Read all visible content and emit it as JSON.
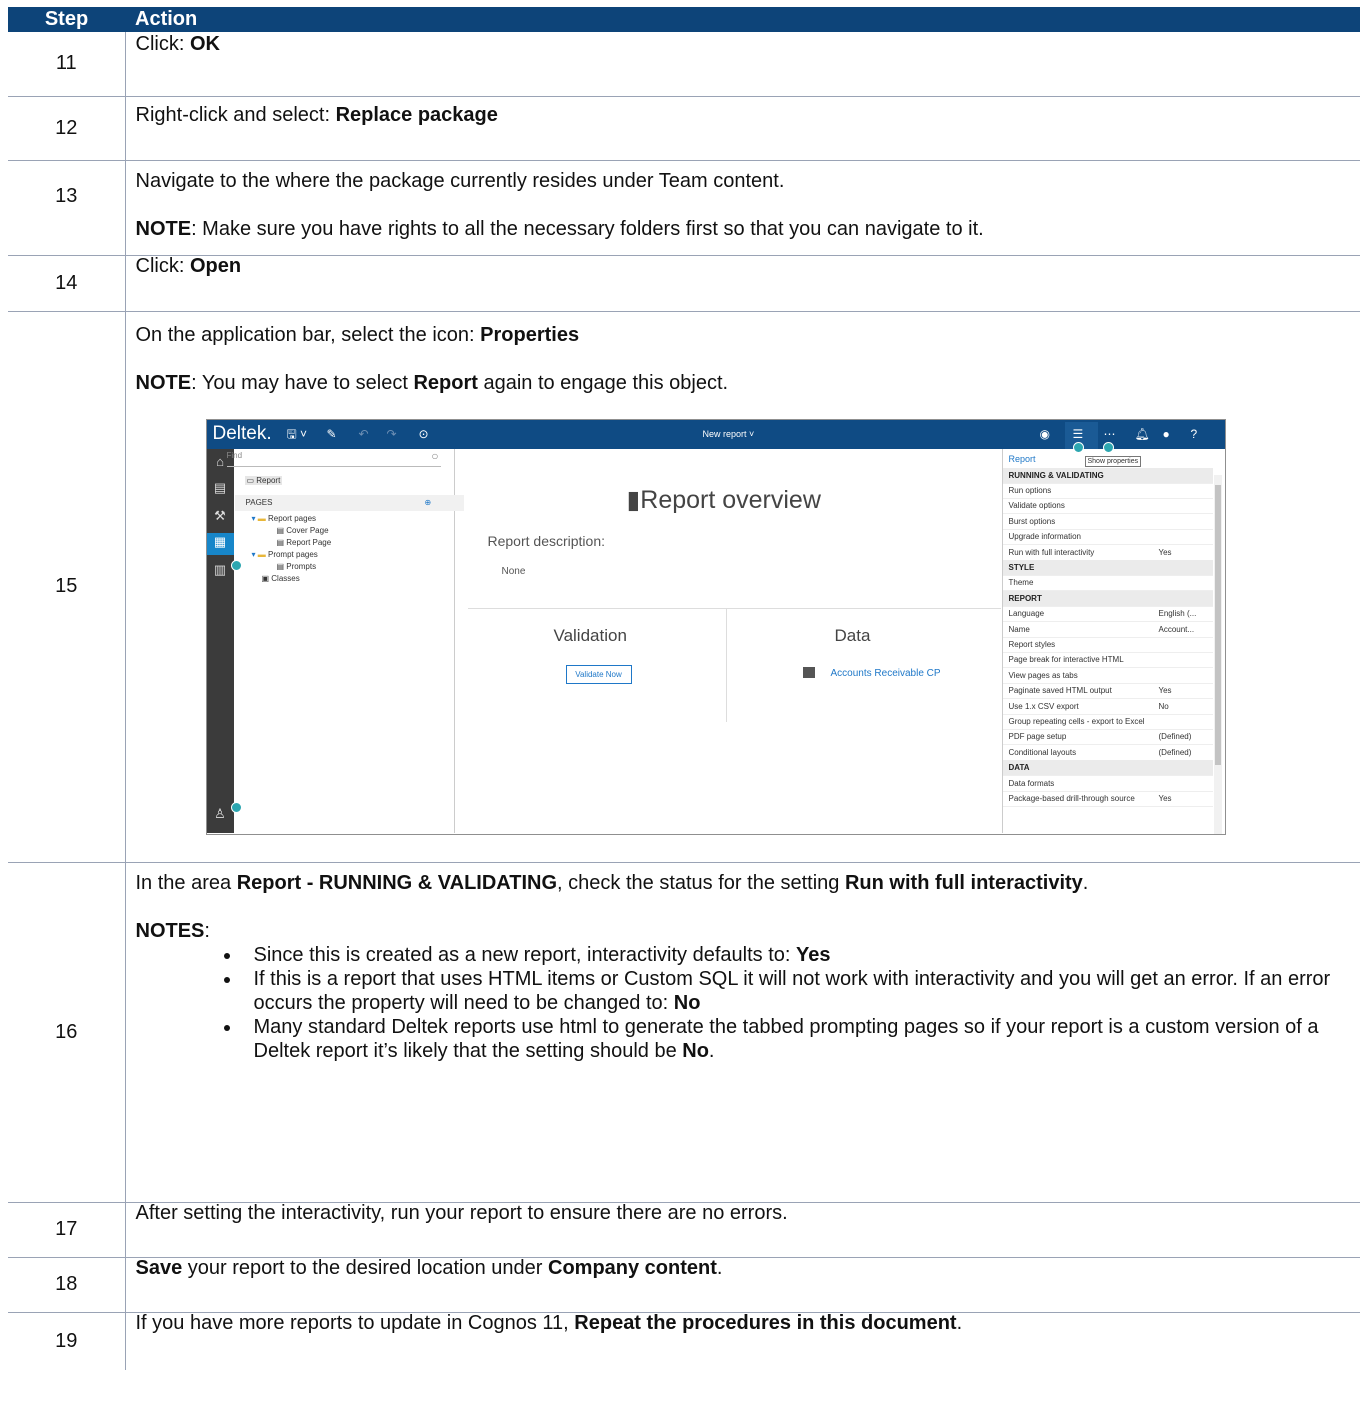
{
  "header": {
    "step": "Step",
    "action": "Action"
  },
  "steps": [
    {
      "num": "11",
      "text": "Click: ",
      "bold": "OK"
    },
    {
      "num": "12",
      "text": "Right-click and select: ",
      "bold": "Replace package"
    },
    {
      "num": "13",
      "line1": "Navigate to the where the package currently resides under Team content.",
      "note_label": "NOTE",
      "note_text": ": Make sure you have rights to all the necessary folders first so that you can navigate to it."
    },
    {
      "num": "14",
      "text": "Click: ",
      "bold": "Open"
    },
    {
      "num": "15",
      "text": "On the application bar, select the icon: ",
      "bold": "Properties",
      "note_label": "NOTE",
      "note_pre": ": You may have to select ",
      "note_bold": "Report",
      "note_post": " again to engage this object."
    },
    {
      "num": "16",
      "pre": "In the area ",
      "b1": "Report - RUNNING & VALIDATING",
      "mid": ", check the status for the setting ",
      "b2": "Run with full interactivity",
      "end": ".",
      "notes_label": "NOTES",
      "notes_colon": ":",
      "bullets": [
        {
          "text": "Since this is created as a new report, interactivity defaults to: ",
          "bold": "Yes",
          "post": ""
        },
        {
          "text": "If this is a report that uses HTML items or Custom SQL it will not work with interactivity and you will get an error. If an error occurs the property will need to be changed to: ",
          "bold": "No",
          "post": ""
        },
        {
          "text": "Many standard Deltek reports use html to generate the tabbed prompting pages so if your report is a custom version of a Deltek report it’s likely that the setting should be ",
          "bold": "No",
          "post": "."
        }
      ]
    },
    {
      "num": "17",
      "text": "After setting the interactivity, run your report to ensure there are no errors."
    },
    {
      "num": "18",
      "b1": "Save",
      "mid": " your report to the desired location under ",
      "b2": "Company content",
      "end": "."
    },
    {
      "num": "19",
      "text": "If you have more reports to update in Cognos 11, ",
      "bold": "Repeat the procedures in this document",
      "end": "."
    }
  ],
  "screenshot": {
    "logo": "Deltek.",
    "title": "New report",
    "find_placeholder": "Find",
    "tree": {
      "report": "Report",
      "pages": "PAGES",
      "report_pages": "Report pages",
      "cover_page": "Cover Page",
      "report_page": "Report Page",
      "prompt_pages": "Prompt pages",
      "prompts": "Prompts",
      "classes": "Classes"
    },
    "overview_title": "Report overview",
    "report_description": "Report description:",
    "none": "None",
    "validation": "Validation",
    "data": "Data",
    "validate_now": "Validate Now",
    "data_source": "Accounts Receivable CP",
    "tooltip": "Show properties",
    "props_title": "Report",
    "props": [
      {
        "k": "RUNNING & VALIDATING",
        "v": "",
        "hdr": true
      },
      {
        "k": "Run options",
        "v": ""
      },
      {
        "k": "Validate options",
        "v": ""
      },
      {
        "k": "Burst options",
        "v": ""
      },
      {
        "k": "Upgrade information",
        "v": ""
      },
      {
        "k": "Run with full interactivity",
        "v": "Yes"
      },
      {
        "k": "STYLE",
        "v": "",
        "hdr": true
      },
      {
        "k": "Theme",
        "v": ""
      },
      {
        "k": "REPORT",
        "v": "",
        "hdr": true
      },
      {
        "k": "Language",
        "v": "English (..."
      },
      {
        "k": "Name",
        "v": "Account..."
      },
      {
        "k": "Report styles",
        "v": ""
      },
      {
        "k": "Page break for interactive HTML",
        "v": ""
      },
      {
        "k": "View pages as tabs",
        "v": ""
      },
      {
        "k": "Paginate saved HTML output",
        "v": "Yes"
      },
      {
        "k": "Use 1.x CSV export",
        "v": "No"
      },
      {
        "k": "Group repeating cells - export to Excel",
        "v": ""
      },
      {
        "k": "PDF page setup",
        "v": "(Defined)"
      },
      {
        "k": "Conditional layouts",
        "v": "(Defined)"
      },
      {
        "k": "DATA",
        "v": "",
        "hdr": true
      },
      {
        "k": "Data formats",
        "v": ""
      },
      {
        "k": "Package-based drill-through source",
        "v": "Yes"
      }
    ]
  }
}
